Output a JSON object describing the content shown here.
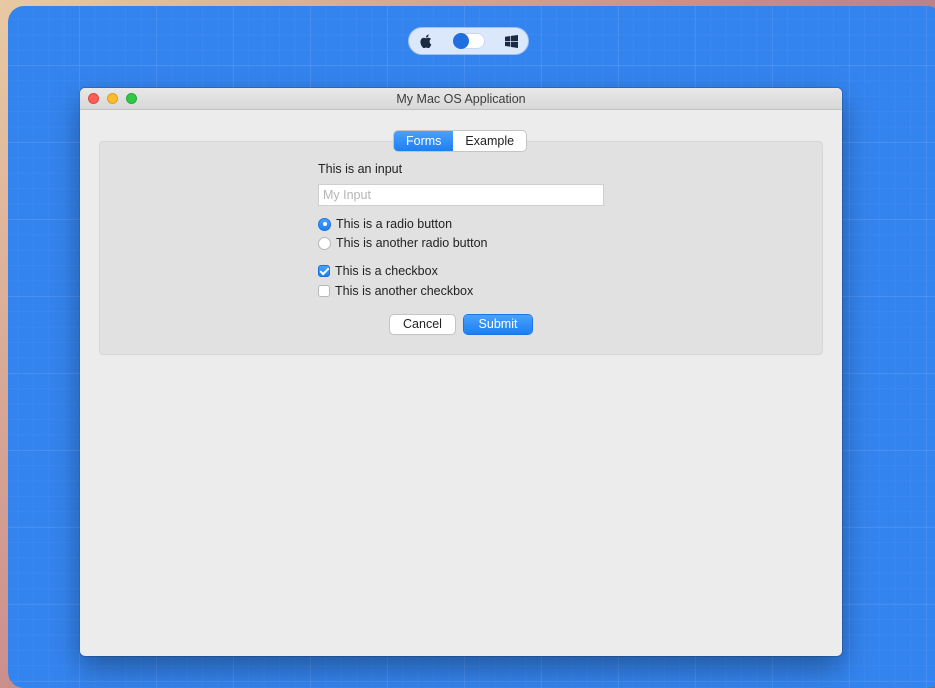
{
  "window": {
    "title": "My Mac OS Application"
  },
  "switcher": {
    "left_icon": "apple-icon",
    "right_icon": "windows-icon",
    "state": "on"
  },
  "tabs": [
    {
      "label": "Forms",
      "active": true
    },
    {
      "label": "Example",
      "active": false
    }
  ],
  "form": {
    "input_label": "This is an input",
    "input_placeholder": "My Input",
    "input_value": "",
    "radios": [
      {
        "label": "This is a radio button",
        "checked": true
      },
      {
        "label": "This is another radio button",
        "checked": false
      }
    ],
    "checkboxes": [
      {
        "label": "This is a checkbox",
        "checked": true
      },
      {
        "label": "This is another checkbox",
        "checked": false
      }
    ],
    "cancel_label": "Cancel",
    "submit_label": "Submit"
  },
  "colors": {
    "accent": "#1b7ff5",
    "desktop": "#3484ef"
  }
}
